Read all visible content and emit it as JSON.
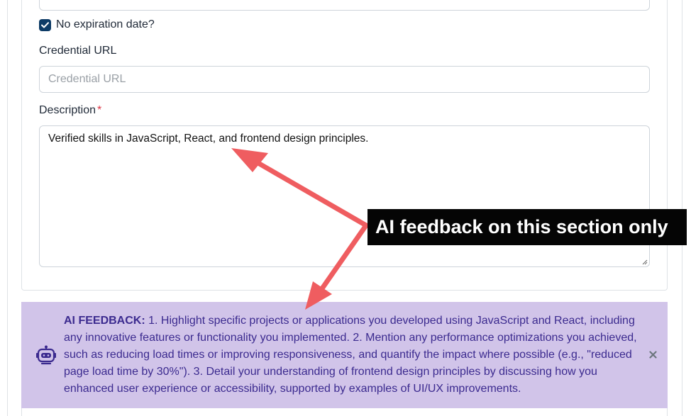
{
  "form": {
    "no_expiration_label": "No expiration date?",
    "no_expiration_checked": true,
    "credential_url": {
      "label": "Credential URL",
      "placeholder": "Credential URL",
      "value": ""
    },
    "description": {
      "label": "Description",
      "required_mark": "*",
      "value": "Verified skills in JavaScript, React, and frontend design principles."
    }
  },
  "ai_feedback": {
    "title": "AI FEEDBACK:",
    "text": "1. Highlight specific projects or applications you developed using JavaScript and React, including any innovative features or functionality you implemented. 2. Mention any performance optimizations you achieved, such as reducing load times or improving responsiveness, and quantify the impact where possible (e.g., \"reduced page load time by 30%\"). 3. Detail your understanding of frontend design principles by discussing how you enhanced user experience or accessibility, supported by examples of UI/UX improvements.",
    "icon": "robot-icon",
    "close_icon": "close-icon"
  },
  "annotation": {
    "callout_text": "AI feedback on this section only",
    "arrow_color": "#ef5d60"
  },
  "colors": {
    "ai_bg": "#d1c4e9",
    "ai_text": "#3b2a8f",
    "checkbox": "#0d3b66",
    "required": "#dc3545"
  }
}
